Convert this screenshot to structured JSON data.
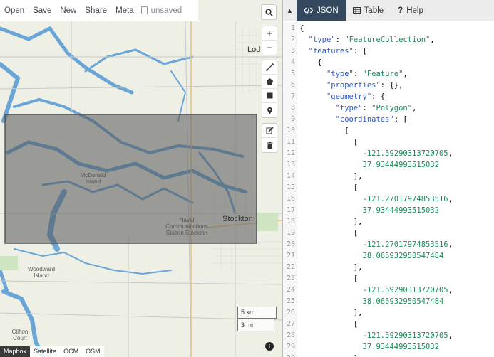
{
  "toolbar": {
    "items": [
      "Open",
      "Save",
      "New",
      "Share",
      "Meta"
    ],
    "status": "unsaved"
  },
  "map": {
    "controls": {
      "zoom_in": "+",
      "zoom_out": "−"
    },
    "scale": {
      "metric": "5 km",
      "imperial": "3 mi"
    },
    "layers": [
      "Mapbox",
      "Satellite",
      "OCM",
      "OSM"
    ],
    "active_layer": "Mapbox",
    "info": "i",
    "places": {
      "lodi": "Lod",
      "mcdonald": "McDonald Island",
      "stockton": "Stockton",
      "naval": "Naval Communications Station Stockton",
      "woodward": "Woodward Island",
      "clifton": "Clifton Court"
    },
    "polygon_color": "#555555"
  },
  "panel": {
    "tabs": [
      {
        "label": "JSON",
        "icon": "code-icon"
      },
      {
        "label": "Table",
        "icon": "table-icon"
      },
      {
        "label": "Help",
        "icon": "help-icon"
      }
    ],
    "active_tab": "JSON",
    "lines": [
      {
        "n": "1",
        "text": "{"
      },
      {
        "n": "2",
        "text": "  \"type\": \"FeatureCollection\","
      },
      {
        "n": "3",
        "text": "  \"features\": ["
      },
      {
        "n": "4",
        "text": "    {"
      },
      {
        "n": "5",
        "text": "      \"type\": \"Feature\","
      },
      {
        "n": "6",
        "text": "      \"properties\": {},"
      },
      {
        "n": "7",
        "text": "      \"geometry\": {"
      },
      {
        "n": "8",
        "text": "        \"type\": \"Polygon\","
      },
      {
        "n": "9",
        "text": "        \"coordinates\": ["
      },
      {
        "n": "10",
        "text": "          ["
      },
      {
        "n": "11",
        "text": "            ["
      },
      {
        "n": "12",
        "text": "              -121.59290313720705,"
      },
      {
        "n": "13",
        "text": "              37.93444993515032"
      },
      {
        "n": "14",
        "text": "            ],"
      },
      {
        "n": "15",
        "text": "            ["
      },
      {
        "n": "16",
        "text": "              -121.27017974853516,"
      },
      {
        "n": "17",
        "text": "              37.93444993515032"
      },
      {
        "n": "18",
        "text": "            ],"
      },
      {
        "n": "19",
        "text": "            ["
      },
      {
        "n": "20",
        "text": "              -121.27017974853516,"
      },
      {
        "n": "21",
        "text": "              38.065932950547484"
      },
      {
        "n": "22",
        "text": "            ],"
      },
      {
        "n": "23",
        "text": "            ["
      },
      {
        "n": "24",
        "text": "              -121.59290313720705,"
      },
      {
        "n": "25",
        "text": "              38.065932950547484"
      },
      {
        "n": "26",
        "text": "            ],"
      },
      {
        "n": "27",
        "text": "            ["
      },
      {
        "n": "28",
        "text": "              -121.59290313720705,"
      },
      {
        "n": "29",
        "text": "              37.93444993515032"
      },
      {
        "n": "30",
        "text": "            ]"
      }
    ]
  }
}
